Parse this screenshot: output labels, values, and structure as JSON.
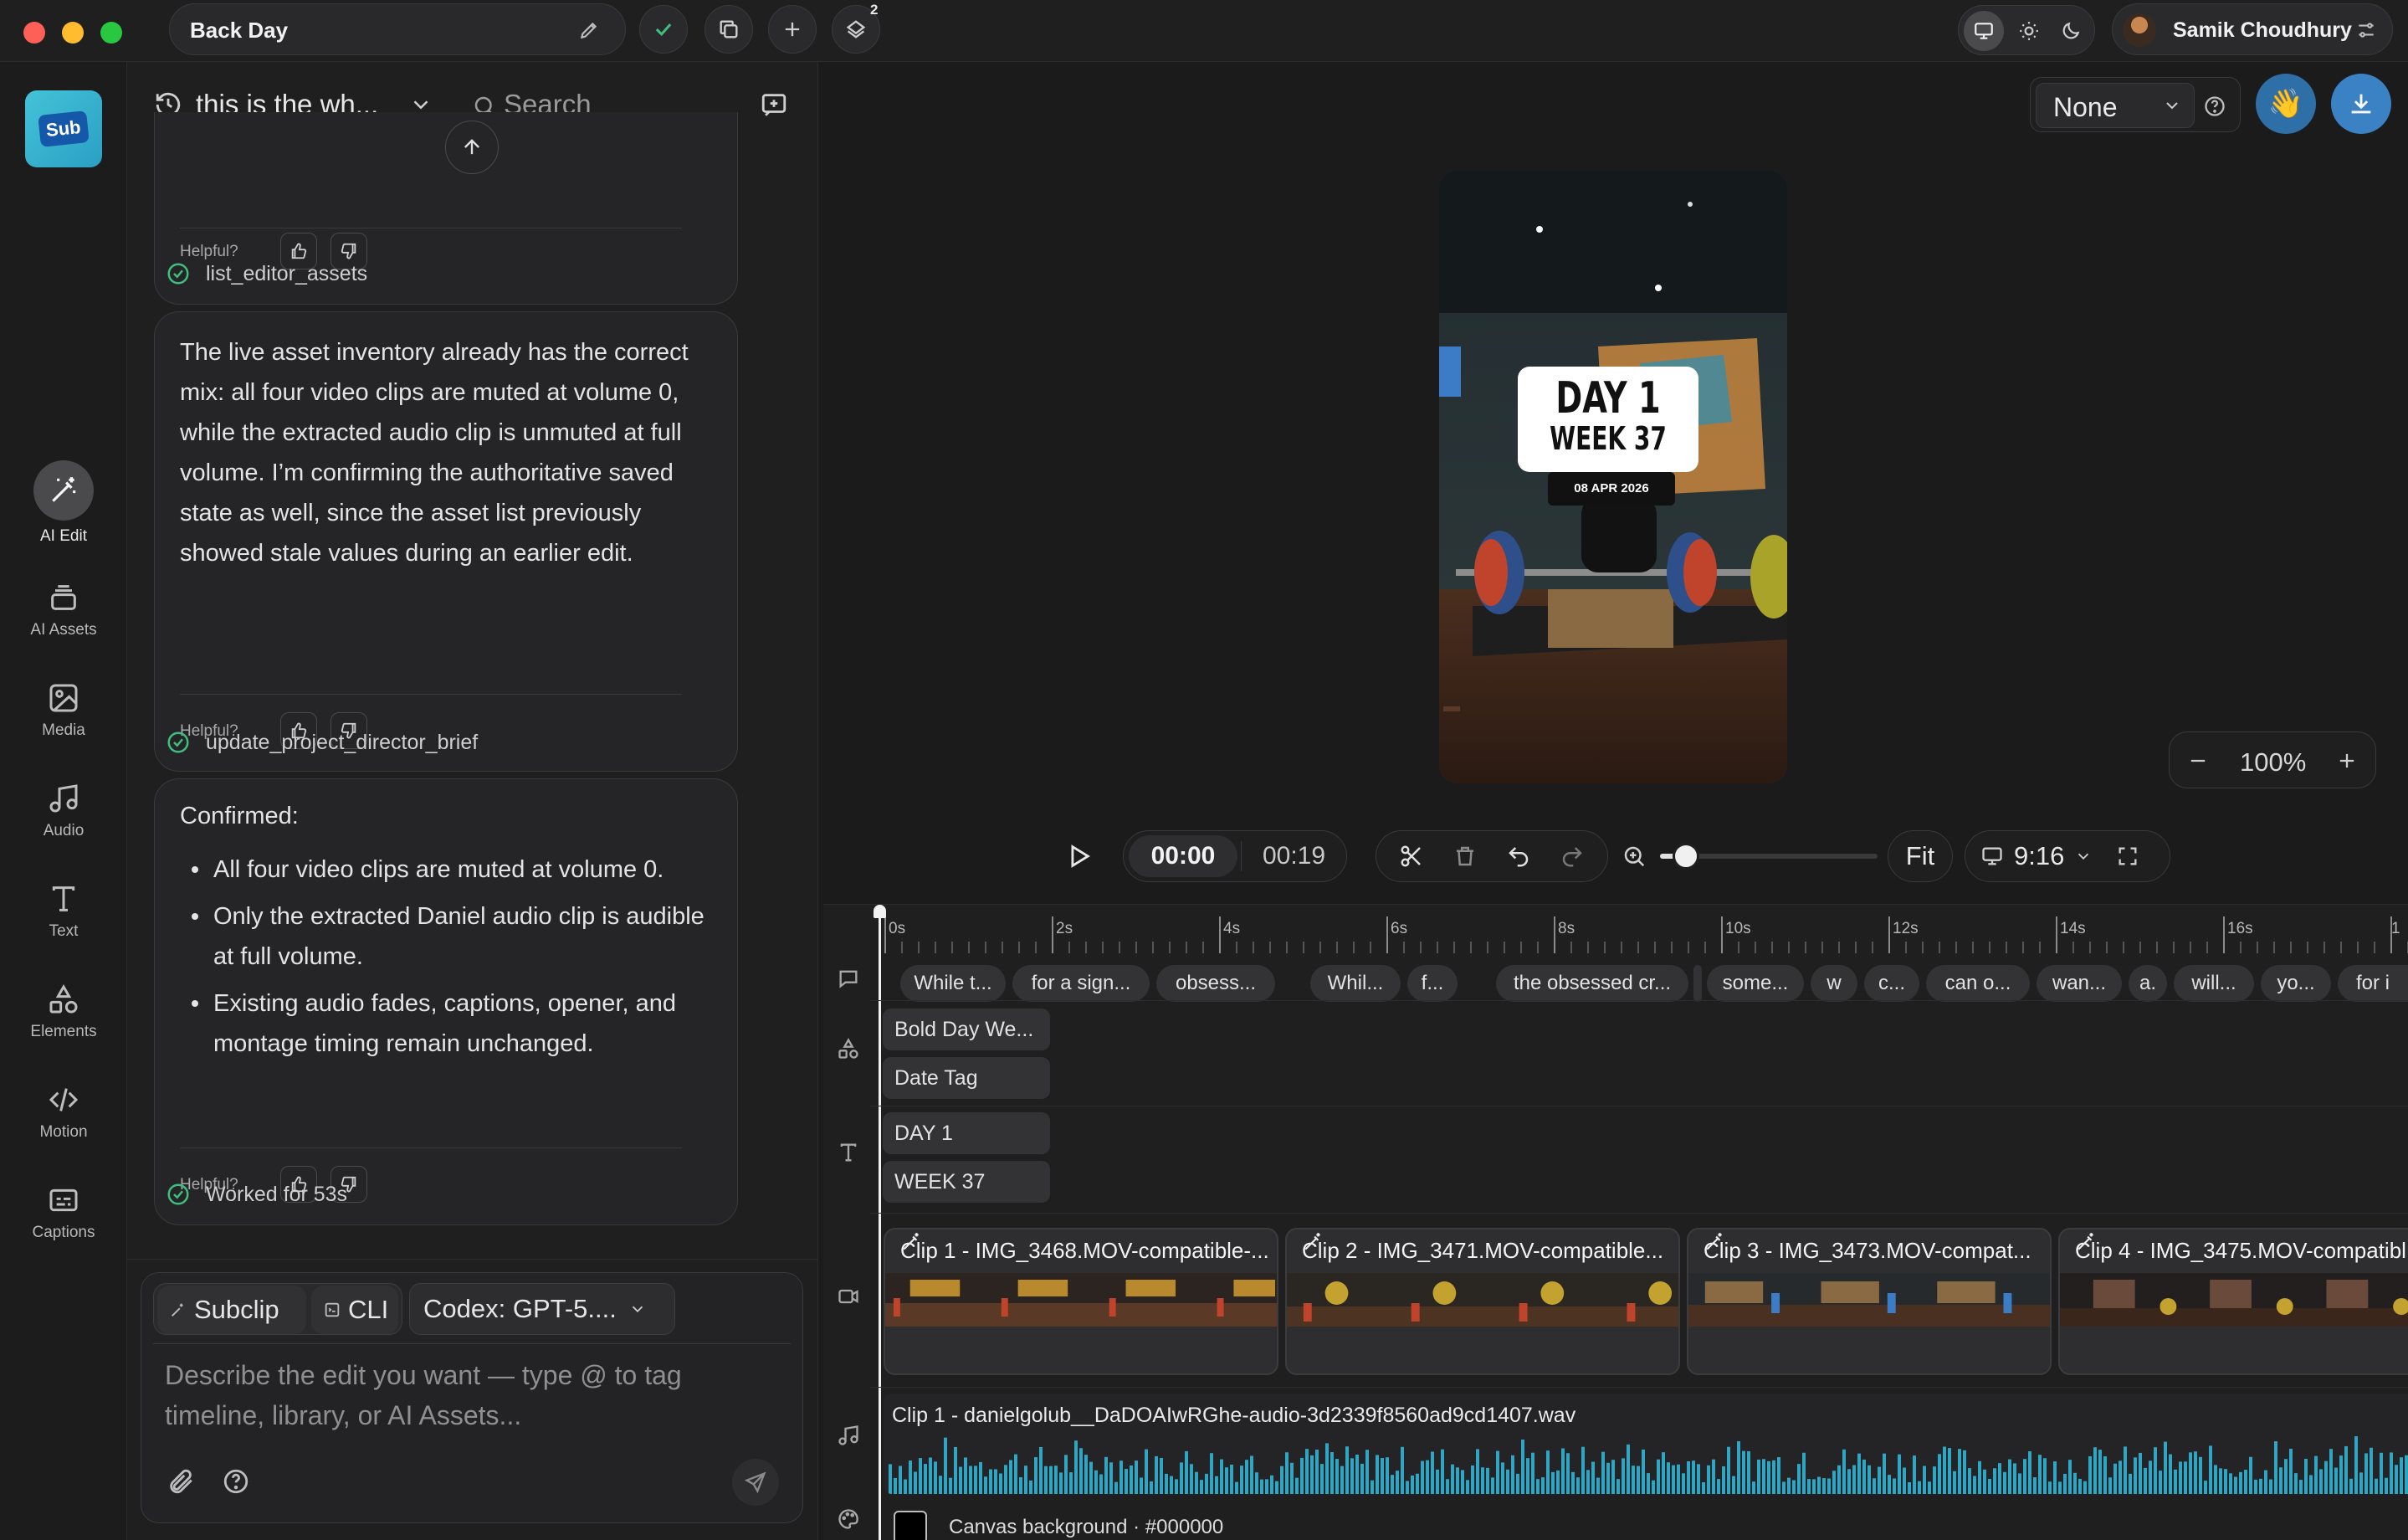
{
  "window": {
    "title": "Back Day",
    "badge_count": "2"
  },
  "user": {
    "name": "Samik Choudhury"
  },
  "sidebar": {
    "logo": "Sub",
    "items": [
      {
        "label": "AI Edit",
        "icon": "magic-wand-icon"
      },
      {
        "label": "AI Assets",
        "icon": "layers-icon"
      },
      {
        "label": "Media",
        "icon": "image-icon"
      },
      {
        "label": "Audio",
        "icon": "music-note-icon"
      },
      {
        "label": "Text",
        "icon": "text-icon"
      },
      {
        "label": "Elements",
        "icon": "shapes-icon"
      },
      {
        "label": "Motion",
        "icon": "code-icon"
      },
      {
        "label": "Captions",
        "icon": "captions-icon"
      }
    ]
  },
  "chat": {
    "thread_title": "this is the wh...",
    "search_placeholder": "Search",
    "helpful_label": "Helpful?",
    "tool_calls": [
      "list_editor_assets",
      "update_project_director_brief"
    ],
    "message_1": "The live asset inventory already has the correct mix: all four video clips are muted at volume 0, while the extracted audio clip is unmuted at full volume. I’m confirming the authoritative saved state as well, since the asset list previously showed stale values during an earlier edit.",
    "message_2_heading": "Confirmed:",
    "message_2_bullets": [
      "All four video clips are muted at volume 0.",
      "Only the extracted Daniel audio clip is audible at full volume.",
      "Existing audio fades, captions, opener, and montage timing remain unchanged."
    ],
    "worked_for": "Worked for 53s"
  },
  "composer": {
    "mode_subclip": "Subclip",
    "mode_cli": "CLI",
    "model": "Codex: GPT-5....",
    "placeholder": "Describe the edit you want — type @ to tag timeline, library, or AI Assets..."
  },
  "preview": {
    "preset": "None",
    "zoom": "100%",
    "overlay_line1": "DAY 1",
    "overlay_line2": "WEEK 37",
    "overlay_date": "08 APR 2026"
  },
  "playback": {
    "current_time": "00:00",
    "duration": "00:19",
    "fit_label": "Fit",
    "aspect": "9:16",
    "zoom_slider": 0.12
  },
  "timeline": {
    "ruler": [
      "0s",
      "2s",
      "4s",
      "6s",
      "8s",
      "10s",
      "12s",
      "14s",
      "16s",
      "1"
    ],
    "captions": [
      "While t...",
      "for a sign...",
      "obsess...",
      "Whil...",
      "f...",
      "the obsessed cr...",
      "",
      "some...",
      "w",
      "c...",
      "can o...",
      "wan...",
      "a.",
      "will...",
      "yo...",
      "for i"
    ],
    "element_tracks": [
      "Bold Day We...",
      "Date Tag"
    ],
    "text_tracks": [
      "DAY 1",
      "WEEK 37"
    ],
    "clips": [
      "Clip 1 - IMG_3468.MOV-compatible-...",
      "Clip 2 - IMG_3471.MOV-compatible...",
      "Clip 3 - IMG_3473.MOV-compat...",
      "Clip 4 - IMG_3475.MOV-compatibl"
    ],
    "audio_clip": "Clip 1 - danielgolub__DaDOAIwRGhe-audio-3d2339f8560ad9cd1407.wav",
    "canvas_bg": "Canvas background · #000000"
  },
  "colors": {
    "accent_blue": "#3b82c4",
    "waveform": "#2fa6c4",
    "success": "#3fbf7f"
  }
}
